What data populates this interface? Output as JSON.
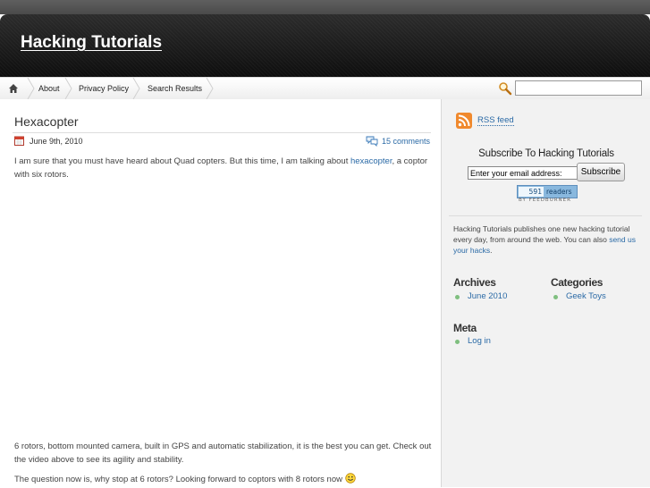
{
  "site": {
    "title": "Hacking Tutorials"
  },
  "nav": {
    "items": [
      {
        "label": "About"
      },
      {
        "label": "Privacy Policy"
      },
      {
        "label": "Search Results"
      }
    ],
    "search_value": ""
  },
  "post": {
    "title": "Hexacopter",
    "date": "June 9th, 2010",
    "comments": "15 comments",
    "intro_before": "I am sure that you must have heard about Quad copters. But this time, I am talking about ",
    "intro_link": "hexacopter",
    "intro_after": ", a coptor with six rotors.",
    "paragraph2": "6 rotors, bottom mounted camera, built in GPS and automatic stabilization, it is the best you can get. Check out the video above to see its agility and stability.",
    "paragraph3": "The question now is, why stop at 6 rotors? Looking forward to coptors with 8 rotors now"
  },
  "sidebar": {
    "rss_label": "RSS feed",
    "subscribe_heading": "Subscribe To Hacking Tutorials",
    "email_value": "Enter your email address:",
    "subscribe_button": "Subscribe",
    "readers_count": "591",
    "readers_label": "readers",
    "by_feedburner": "BY FEEDBURNER",
    "about_text": "Hacking Tutorials publishes one new hacking tutorial every day, from around the web. You can also ",
    "about_link": "send us your hacks",
    "about_end": ".",
    "archives_title": "Archives",
    "archives_items": [
      "June 2010"
    ],
    "categories_title": "Categories",
    "categories_items": [
      "Geek Toys"
    ],
    "meta_title": "Meta",
    "meta_items": [
      "Log in"
    ]
  },
  "colors": {
    "link": "#2b6aa6",
    "header_bg": "#111111",
    "sidebar_bg": "#f2f2f2",
    "bullet": "#7fbf7f",
    "rss_orange": "#f0892d"
  },
  "icons": {
    "home": "home-icon",
    "search": "search-icon",
    "calendar": "calendar-icon",
    "comments": "comments-icon",
    "rss": "rss-icon",
    "smiley": "smiley-icon"
  }
}
